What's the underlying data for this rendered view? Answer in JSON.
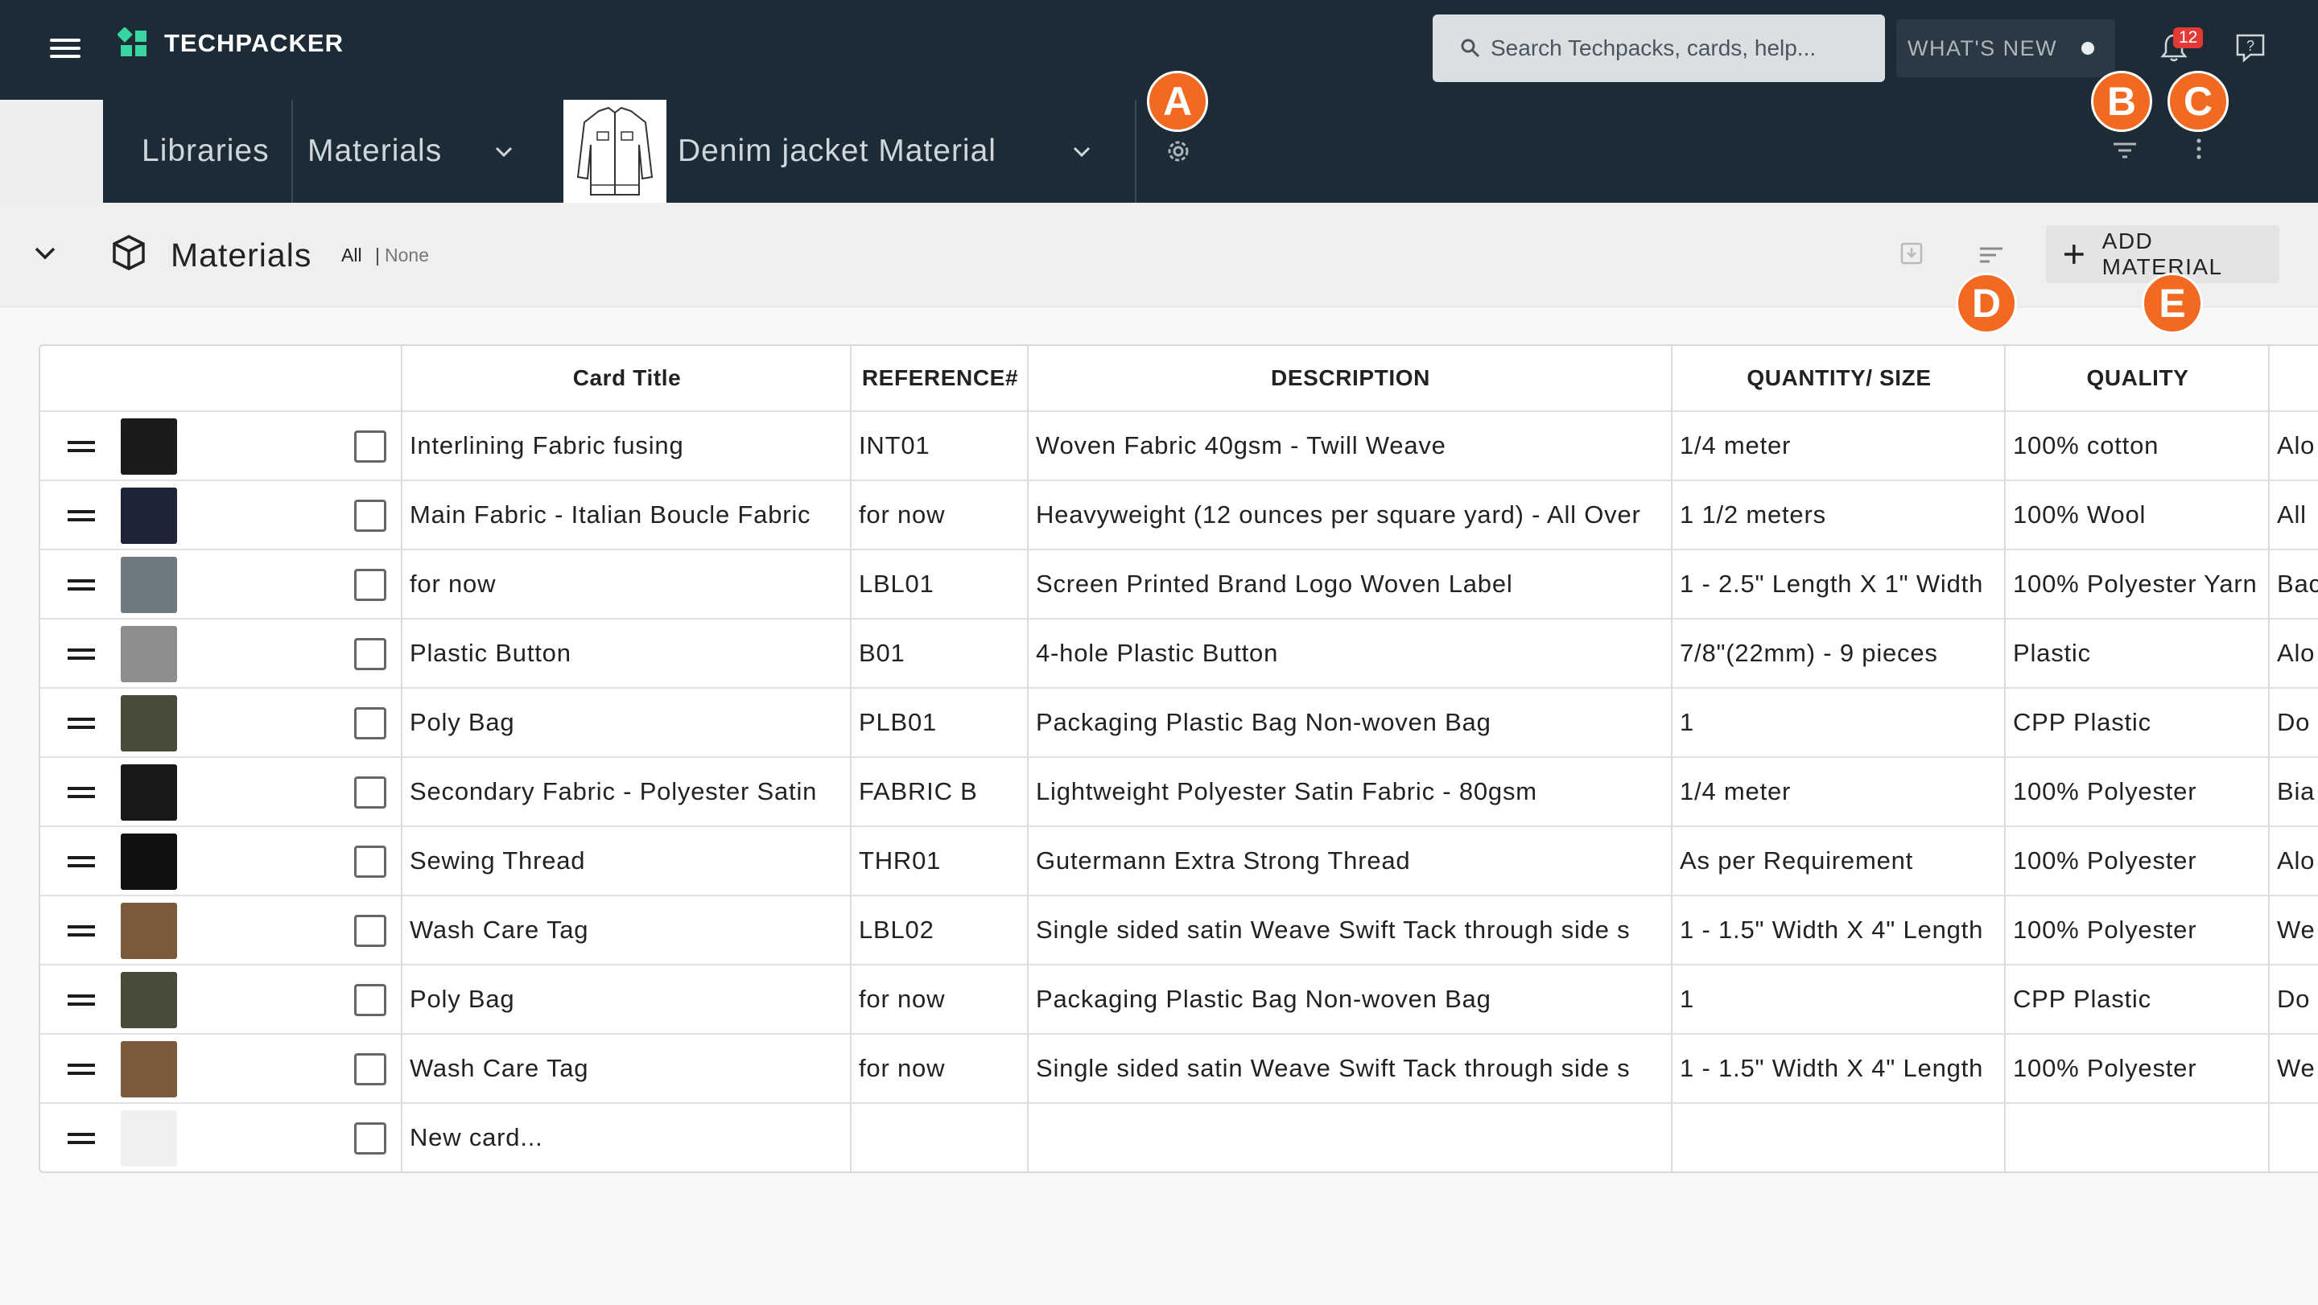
{
  "app": {
    "name": "TECHPACKER"
  },
  "search": {
    "placeholder": "Search Techpacks, cards, help..."
  },
  "header": {
    "whats_new": "WHAT'S NEW",
    "notification_count": "12"
  },
  "breadcrumb": {
    "libraries": "Libraries",
    "materials": "Materials",
    "techpack": "Denim jacket Material"
  },
  "callouts": {
    "a": "A",
    "b": "B",
    "c": "C",
    "d": "D",
    "e": "E"
  },
  "section": {
    "title": "Materials",
    "select_all": "All",
    "separator": "|",
    "select_none": "None",
    "add_button": "ADD MATERIAL"
  },
  "table": {
    "columns": [
      "Card Title",
      "REFERENCE#",
      "DESCRIPTION",
      "QUANTITY/ SIZE",
      "QUALITY"
    ],
    "rows": [
      {
        "title": "Interlining Fabric fusing",
        "ref": "INT01",
        "desc": "Woven Fabric 40gsm - Twill Weave",
        "qty": "1/4 meter",
        "quality": "100% cotton",
        "extra": "Alo",
        "thumb": "#1b1b1b"
      },
      {
        "title": "Main Fabric - Italian Boucle Fabric",
        "ref": "for now",
        "desc": "Heavyweight (12 ounces per square yard) - All Over",
        "qty": "1 1/2 meters",
        "quality": "100% Wool",
        "extra": "All",
        "thumb": "#1e2338"
      },
      {
        "title": "for now",
        "ref": "LBL01",
        "desc": "Screen Printed Brand Logo Woven Label",
        "qty": "1 - 2.5\" Length X 1\" Width",
        "quality": "100% Polyester Yarn",
        "extra": "Bac",
        "thumb": "#6f7a80"
      },
      {
        "title": "Plastic Button",
        "ref": "B01",
        "desc": "4-hole Plastic Button",
        "qty": "7/8\"(22mm) - 9 pieces",
        "quality": "Plastic",
        "extra": "Alo",
        "thumb": "#8d8d8d"
      },
      {
        "title": "Poly Bag",
        "ref": "PLB01",
        "desc": "Packaging Plastic Bag Non-woven Bag",
        "qty": "1",
        "quality": "CPP Plastic",
        "extra": "Do",
        "thumb": "#4a4a3a"
      },
      {
        "title": "Secondary Fabric - Polyester Satin",
        "ref": "FABRIC B",
        "desc": "Lightweight Polyester Satin Fabric - 80gsm",
        "qty": "1/4 meter",
        "quality": "100% Polyester",
        "extra": "Bia",
        "thumb": "#181818"
      },
      {
        "title": "Sewing Thread",
        "ref": "THR01",
        "desc": "Gutermann Extra Strong Thread",
        "qty": "As per Requirement",
        "quality": "100% Polyester",
        "extra": "Alo",
        "thumb": "#101010"
      },
      {
        "title": "Wash Care Tag",
        "ref": "LBL02",
        "desc": "Single sided satin Weave Swift Tack through side s",
        "qty": "1 - 1.5\" Width X 4\" Length",
        "quality": "100% Polyester",
        "extra": "We",
        "thumb": "#7a5a3a"
      },
      {
        "title": "Poly Bag",
        "ref": "for now",
        "desc": "Packaging Plastic Bag Non-woven Bag",
        "qty": "1",
        "quality": "CPP Plastic",
        "extra": "Do",
        "thumb": "#4a4a3a"
      },
      {
        "title": "Wash Care Tag",
        "ref": "for now",
        "desc": "Single sided satin Weave Swift Tack through side s",
        "qty": "1 - 1.5\" Width X 4\" Length",
        "quality": "100% Polyester",
        "extra": "We",
        "thumb": "#7a5a3a"
      },
      {
        "title": "New card...",
        "ref": "",
        "desc": "",
        "qty": "",
        "quality": "",
        "extra": "",
        "thumb": "#efefef"
      }
    ]
  },
  "colors": {
    "nav_bg": "#1c2b36",
    "callout": "#f26a21",
    "badge": "#e53935",
    "logo": "#3ad6a0"
  },
  "icons": [
    "menu-icon",
    "logo-icon",
    "search-icon",
    "bell-icon",
    "help-icon",
    "chevron-down-icon",
    "gear-icon",
    "filter-icon",
    "more-vertical-icon",
    "cube-icon",
    "download-icon",
    "sort-icon",
    "plus-icon",
    "drag-handle-icon",
    "checkbox-icon"
  ]
}
